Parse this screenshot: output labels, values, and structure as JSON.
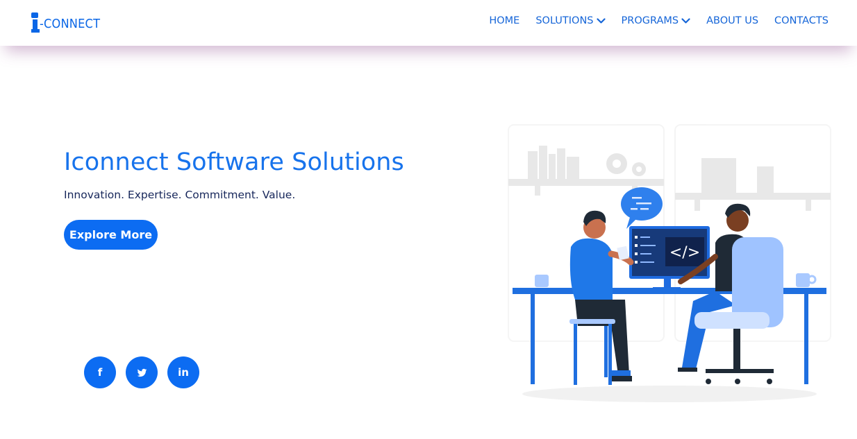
{
  "brand": {
    "logo_text": "-CONNECT",
    "color": "#0a66e6"
  },
  "nav": {
    "items": [
      {
        "label": "HOME",
        "dropdown": false
      },
      {
        "label": "SOLUTIONS",
        "dropdown": true
      },
      {
        "label": "PROGRAMS",
        "dropdown": true
      },
      {
        "label": "ABOUT US",
        "dropdown": false
      },
      {
        "label": "CONTACTS",
        "dropdown": false
      }
    ]
  },
  "hero": {
    "title": "Iconnect Software Solutions",
    "tagline": "Innovation. Expertise. Commitment. Value.",
    "cta_label": "Explore More"
  },
  "social": {
    "facebook_glyph": "f",
    "linkedin_glyph": "in",
    "icons": [
      "facebook-icon",
      "twitter-icon",
      "linkedin-icon"
    ]
  },
  "screen": {
    "code_glyph": "</>"
  },
  "colors": {
    "accent": "#0c6cf2",
    "nav_text": "#1565d8",
    "title": "#1773ec",
    "tagline": "#16265a"
  }
}
